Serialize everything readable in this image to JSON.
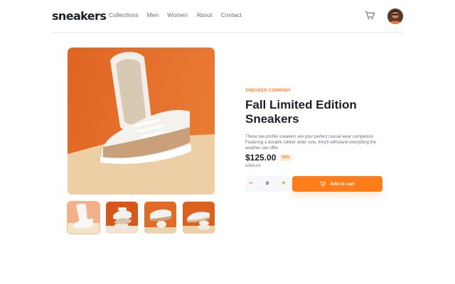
{
  "header": {
    "logo": "sneakers",
    "nav": [
      "Collections",
      "Men",
      "Women",
      "About",
      "Contact"
    ]
  },
  "product": {
    "company": "SNEAKER COMPANY",
    "title": "Fall Limited Edition Sneakers",
    "description": "These low-profile sneakers are your perfect casual wear companion. Featuring a durable rubber outer sole, they'll withstand everything the weather can offer.",
    "price": "$125.00",
    "discount": "50%",
    "old_price": "$250.00"
  },
  "cart": {
    "quantity": "0",
    "minus": "−",
    "plus": "+",
    "add_label": "Add to cart"
  },
  "gallery": {
    "thumbnail_count": 4,
    "active_thumbnail": 1
  },
  "colors": {
    "accent": "#ff7e1b",
    "accent_pale": "#ffede0",
    "dark": "#1d2026",
    "muted": "#69707d"
  }
}
